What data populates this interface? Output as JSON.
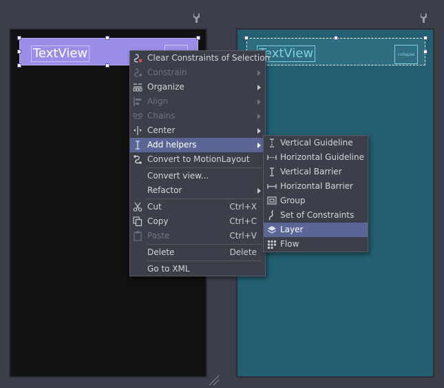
{
  "design_view": {
    "textview_label": "TextView"
  },
  "blueprint_view": {
    "textview_label": "TextView",
    "inner_label": "collapse"
  },
  "context_menu": {
    "items": [
      {
        "label": "Clear Constraints of Selection",
        "icon": "clear-constraints-icon",
        "enabled": true
      },
      {
        "label": "Constrain",
        "icon": "constrain-icon",
        "enabled": false,
        "submenu": true
      },
      {
        "label": "Organize",
        "icon": "organize-icon",
        "enabled": true,
        "submenu": true
      },
      {
        "label": "Align",
        "icon": "align-icon",
        "enabled": false,
        "submenu": true
      },
      {
        "label": "Chains",
        "icon": "chains-icon",
        "enabled": false,
        "submenu": true
      },
      {
        "label": "Center",
        "icon": "center-icon",
        "enabled": true,
        "submenu": true
      },
      {
        "label": "Add helpers",
        "icon": "add-helpers-icon",
        "enabled": true,
        "submenu": true,
        "highlighted": true
      },
      {
        "label": "Convert to MotionLayout",
        "icon": "motion-layout-icon",
        "enabled": true
      },
      {
        "label": "Convert view...",
        "enabled": true
      },
      {
        "label": "Refactor",
        "enabled": true,
        "submenu": true
      },
      {
        "label": "Cut",
        "icon": "cut-icon",
        "shortcut": "Ctrl+X",
        "enabled": true
      },
      {
        "label": "Copy",
        "icon": "copy-icon",
        "shortcut": "Ctrl+C",
        "enabled": true
      },
      {
        "label": "Paste",
        "icon": "paste-icon",
        "shortcut": "Ctrl+V",
        "enabled": false
      },
      {
        "label": "Delete",
        "shortcut": "Delete",
        "enabled": true
      },
      {
        "label": "Go to XML",
        "enabled": true
      }
    ]
  },
  "helpers_submenu": {
    "items": [
      {
        "label": "Vertical Guideline",
        "icon": "vertical-guideline-icon"
      },
      {
        "label": "Horizontal Guideline",
        "icon": "horizontal-guideline-icon"
      },
      {
        "label": "Vertical Barrier",
        "icon": "vertical-barrier-icon"
      },
      {
        "label": "Horizontal Barrier",
        "icon": "horizontal-barrier-icon"
      },
      {
        "label": "Group",
        "icon": "group-icon"
      },
      {
        "label": "Set of Constraints",
        "icon": "set-of-constraints-icon"
      },
      {
        "label": "Layer",
        "icon": "layer-icon",
        "highlighted": true
      },
      {
        "label": "Flow",
        "icon": "flow-icon"
      }
    ]
  },
  "colors": {
    "background": "#3c3f4a",
    "menu_highlight": "#5b6696",
    "design_surface": "#111111",
    "blueprint_surface": "#235f70",
    "textview_fill": "#9b8ee8"
  }
}
